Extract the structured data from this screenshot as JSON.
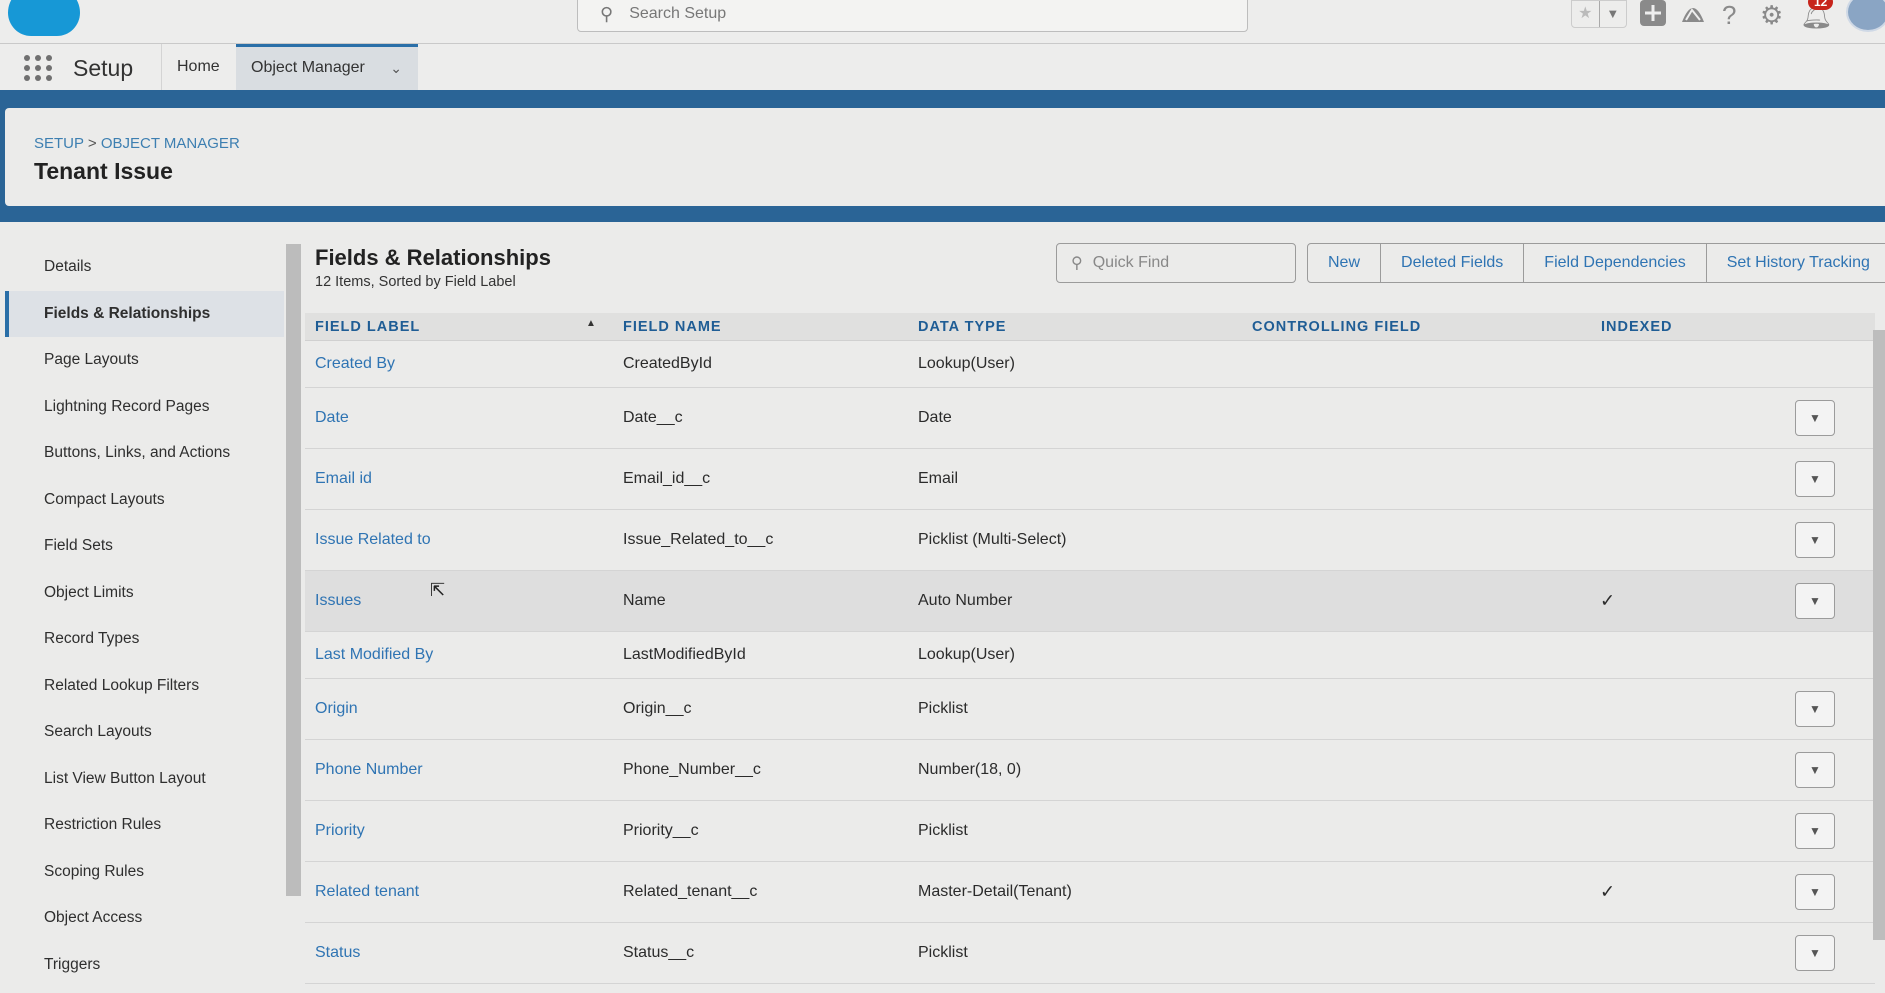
{
  "topbar": {
    "search_placeholder": "Search Setup",
    "notification_count": "12",
    "icons": [
      "salesforce-logo",
      "search-icon",
      "star-icon",
      "chevron-down-icon",
      "plus-icon",
      "trailhead-icon",
      "help-icon",
      "gear-icon",
      "bell-icon",
      "avatar"
    ]
  },
  "nav": {
    "app_title": "Setup",
    "tabs": [
      {
        "label": "Home"
      },
      {
        "label": "Object Manager"
      }
    ]
  },
  "header": {
    "breadcrumb": [
      "SETUP",
      ">",
      "OBJECT MANAGER"
    ],
    "title": "Tenant Issue"
  },
  "sidebar": {
    "items": [
      "Details",
      "Fields & Relationships",
      "Page Layouts",
      "Lightning Record Pages",
      "Buttons, Links, and Actions",
      "Compact Layouts",
      "Field Sets",
      "Object Limits",
      "Record Types",
      "Related Lookup Filters",
      "Search Layouts",
      "List View Button Layout",
      "Restriction Rules",
      "Scoping Rules",
      "Object Access",
      "Triggers"
    ],
    "active": "Fields & Relationships"
  },
  "main": {
    "title": "Fields & Relationships",
    "subtitle": "12 Items, Sorted by Field Label",
    "quick_find_placeholder": "Quick Find",
    "buttons": [
      "New",
      "Deleted Fields",
      "Field Dependencies",
      "Set History Tracking"
    ],
    "columns": [
      "FIELD LABEL",
      "FIELD NAME",
      "DATA TYPE",
      "CONTROLLING FIELD",
      "INDEXED"
    ],
    "rows": [
      {
        "label": "Created By",
        "name": "CreatedById",
        "type": "Lookup(User)",
        "controlling": "",
        "indexed": "",
        "action": false
      },
      {
        "label": "Date",
        "name": "Date__c",
        "type": "Date",
        "controlling": "",
        "indexed": "",
        "action": true
      },
      {
        "label": "Email id",
        "name": "Email_id__c",
        "type": "Email",
        "controlling": "",
        "indexed": "",
        "action": true
      },
      {
        "label": "Issue Related to",
        "name": "Issue_Related_to__c",
        "type": "Picklist (Multi-Select)",
        "controlling": "",
        "indexed": "",
        "action": true
      },
      {
        "label": "Issues",
        "name": "Name",
        "type": "Auto Number",
        "controlling": "",
        "indexed": "✓",
        "action": true
      },
      {
        "label": "Last Modified By",
        "name": "LastModifiedById",
        "type": "Lookup(User)",
        "controlling": "",
        "indexed": "",
        "action": false
      },
      {
        "label": "Origin",
        "name": "Origin__c",
        "type": "Picklist",
        "controlling": "",
        "indexed": "",
        "action": true
      },
      {
        "label": "Phone Number",
        "name": "Phone_Number__c",
        "type": "Number(18, 0)",
        "controlling": "",
        "indexed": "",
        "action": true
      },
      {
        "label": "Priority",
        "name": "Priority__c",
        "type": "Picklist",
        "controlling": "",
        "indexed": "",
        "action": true
      },
      {
        "label": "Related tenant",
        "name": "Related_tenant__c",
        "type": "Master-Detail(Tenant)",
        "controlling": "",
        "indexed": "✓",
        "action": true
      },
      {
        "label": "Status",
        "name": "Status__c",
        "type": "Picklist",
        "controlling": "",
        "indexed": "",
        "action": true
      }
    ]
  }
}
